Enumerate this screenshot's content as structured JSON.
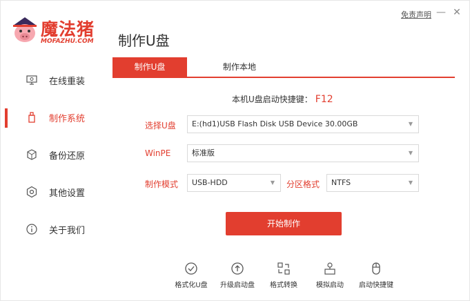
{
  "header": {
    "logo_cn": "魔法猪",
    "logo_en": "MOFAZHU.COM",
    "title": "制作U盘",
    "disclaimer": "免责声明",
    "minimize": "—",
    "close": "✕"
  },
  "sidebar": {
    "items": [
      {
        "label": "在线重装",
        "icon": "monitor-icon"
      },
      {
        "label": "制作系统",
        "icon": "usb-icon"
      },
      {
        "label": "备份还原",
        "icon": "backup-icon"
      },
      {
        "label": "其他设置",
        "icon": "gear-icon"
      },
      {
        "label": "关于我们",
        "icon": "info-icon"
      }
    ],
    "active_index": 1
  },
  "tabs": [
    {
      "label": "制作U盘"
    },
    {
      "label": "制作本地"
    }
  ],
  "hotkey": {
    "label": "本机U盘启动快捷键：",
    "key": "F12"
  },
  "form": {
    "usb_label": "选择U盘",
    "usb_value": "E:(hd1)USB Flash Disk USB Device 30.00GB",
    "winpe_label": "WinPE",
    "winpe_value": "标准版",
    "mode_label": "制作模式",
    "mode_value": "USB-HDD",
    "partition_label": "分区格式",
    "partition_value": "NTFS"
  },
  "start_button": "开始制作",
  "tools": [
    {
      "label": "格式化U盘",
      "icon": "check-circle-icon"
    },
    {
      "label": "升级启动盘",
      "icon": "arrow-up-circle-icon"
    },
    {
      "label": "格式转换",
      "icon": "convert-icon"
    },
    {
      "label": "模拟启动",
      "icon": "simulate-icon"
    },
    {
      "label": "启动快捷键",
      "icon": "mouse-icon"
    }
  ],
  "colors": {
    "accent": "#e23e2f"
  }
}
